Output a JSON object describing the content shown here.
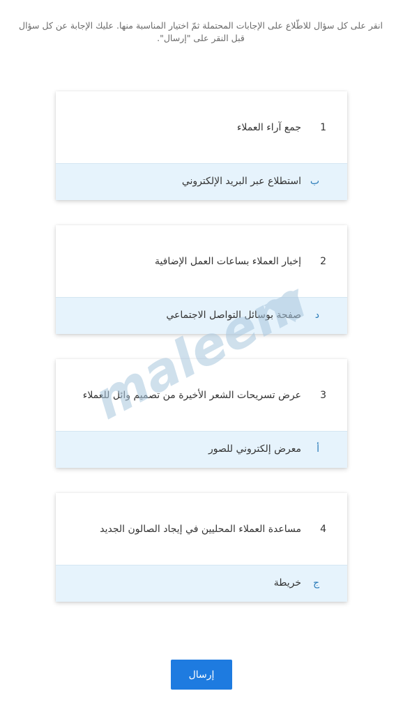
{
  "instructions": "انقر على كل سؤال للاطّلاع على الإجابات المحتملة ثمّ اختيار المناسبة منها. عليك الإجابة عن كل سؤال قبل النقر على \"إرسال\".",
  "questions": [
    {
      "number": "1",
      "text": "جمع آراء العملاء",
      "answer_letter": "ب",
      "answer_text": "استطلاع عبر البريد الإلكتروني"
    },
    {
      "number": "2",
      "text": "إخبار العملاء بساعات العمل الإضافية",
      "answer_letter": "د",
      "answer_text": "صفحة بوسائل التواصل الاجتماعي"
    },
    {
      "number": "3",
      "text": "عرض تسريحات الشعر الأخيرة من تصميم وائل للعملاء",
      "answer_letter": "أ",
      "answer_text": "معرض إلكتروني للصور"
    },
    {
      "number": "4",
      "text": "مساعدة العملاء المحليين في إيجاد الصالون الجديد",
      "answer_letter": "ج",
      "answer_text": "خريطة"
    }
  ],
  "watermark_text": "maleem",
  "submit_label": "إرسال",
  "colors": {
    "accent": "#1e7be0",
    "answer_background": "#e6f3fc",
    "answer_letter": "#2a7bb8",
    "watermark": "#a9c7de"
  }
}
